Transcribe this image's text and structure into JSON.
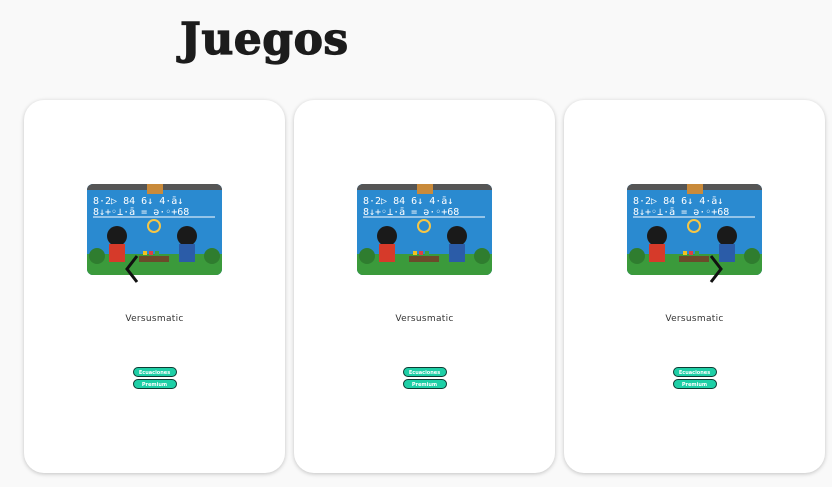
{
  "page": {
    "title": "Juegos"
  },
  "cards": [
    {
      "name": "Versusmatic",
      "tags": [
        "Ecuaciones",
        "Premium"
      ]
    },
    {
      "name": "Versusmatic",
      "tags": [
        "Ecuaciones",
        "Premium"
      ]
    },
    {
      "name": "Versusmatic",
      "tags": [
        "Ecuaciones",
        "Premium"
      ]
    }
  ],
  "thumbnail_equations": [
    "8·2▷ 84  6↓ 4·ā↓",
    "8↓+◦⊥·ā = ǝ·◦+68"
  ],
  "colors": {
    "tag_bg": "#1ecfa6",
    "tag_border": "#0d3b33",
    "thumb_bg": "#2a8ad0",
    "title": "#1c1c1c"
  },
  "icons": {
    "prev": "chevron-left-icon",
    "next": "chevron-right-icon"
  }
}
